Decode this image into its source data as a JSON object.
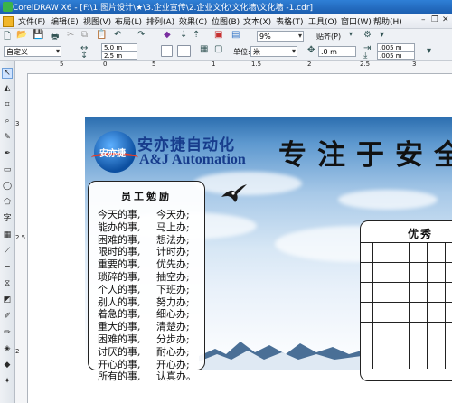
{
  "window": {
    "title": "CorelDRAW X6 - [F:\\1.图片设计\\★\\3.企业宣传\\2.企业文化\\文化墙\\文化墙 -1.cdr]"
  },
  "menu": [
    "文件(F)",
    "编辑(E)",
    "视图(V)",
    "布局(L)",
    "排列(A)",
    "效果(C)",
    "位图(B)",
    "文本(X)",
    "表格(T)",
    "工具(O)",
    "窗口(W)",
    "帮助(H)"
  ],
  "standard_toolbar": {
    "zoom": "9%",
    "snap_to": "贴齐(P)"
  },
  "property_bar": {
    "paper_preset": "自定义",
    "width": "5.0 m",
    "height": "2.5 m",
    "units_label": "单位:",
    "units": "米",
    "nudge": ".0 m",
    "dup_x": ".005 m",
    "dup_y": ".005 m"
  },
  "ruler": {
    "top_numbers": [
      "5",
      "0",
      "5",
      "1",
      "1.5",
      "2",
      "2.5",
      "3"
    ],
    "left_numbers": [
      "3",
      "2.5",
      "2"
    ]
  },
  "canvas": {
    "logo_text": "安亦捷",
    "company_cn": "安亦捷自动化",
    "company_en": "A&J Automation",
    "slogan": "专注于安全",
    "panel_title": "员工勉励",
    "couplet_left": [
      "今天的事,",
      "能办的事,",
      "困难的事,",
      "限时的事,",
      "重要的事,",
      "琐碎的事,",
      "个人的事,",
      "别人的事,",
      "着急的事,",
      "重大的事,",
      "困难的事,",
      "讨厌的事,",
      "开心的事,",
      "所有的事,"
    ],
    "couplet_right": [
      "今天办;",
      "马上办;",
      "想法办;",
      "计时办;",
      "优先办;",
      "抽空办;",
      "下班办;",
      "努力办;",
      "细心办;",
      "清楚办;",
      "分步办;",
      "耐心办;",
      "开心办;",
      "认真办。"
    ],
    "table_title": "优秀"
  }
}
